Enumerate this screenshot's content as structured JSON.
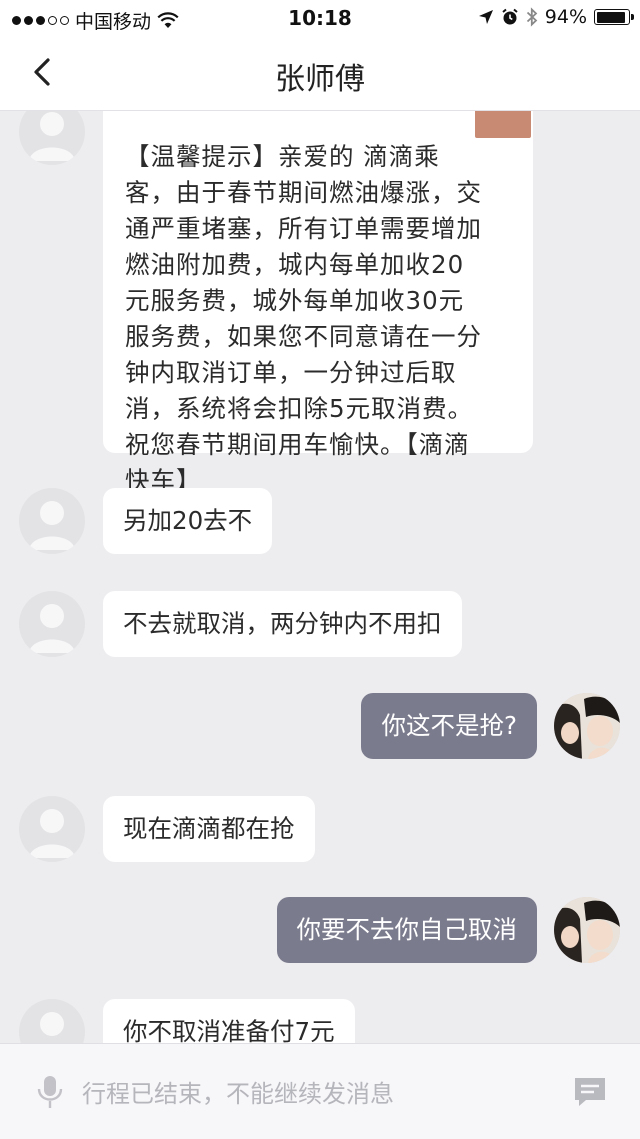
{
  "status_bar": {
    "carrier": "中国移动",
    "time": "10:18",
    "battery_percent": "94%",
    "battery_level": 0.94,
    "signal_bars_filled": 3,
    "signal_bars_total": 5
  },
  "nav": {
    "title": "张师傅",
    "back_icon": "chevron-left-icon"
  },
  "messages": [
    {
      "sender": "driver",
      "text": "【温馨提示】亲爱的     滴滴乘\n客，由于春节期间燃油爆涨，交\n通严重堵塞，所有订单需要增加\n燃油附加费，城内每单加收20\n元服务费，城外每单加收30元\n服务费，如果您不同意请在一分\n钟内取消订单，一分钟过后取\n消，系统将会扣除5元取消费。\n祝您春节期间用车愉快。【滴滴\n快车】"
    },
    {
      "sender": "driver",
      "text": "另加20去不"
    },
    {
      "sender": "driver",
      "text": "不去就取消，两分钟内不用扣"
    },
    {
      "sender": "me",
      "text": "你这不是抢?"
    },
    {
      "sender": "driver",
      "text": "现在滴滴都在抢"
    },
    {
      "sender": "me",
      "text": "你要不去你自己取消"
    },
    {
      "sender": "driver",
      "text": "你不取消准备付7元"
    }
  ],
  "input_bar": {
    "placeholder": "行程已结束，不能继续发消息",
    "mic_icon": "microphone-icon",
    "message_icon": "message-icon"
  },
  "colors": {
    "background": "#ededf0",
    "incoming_bubble": "#ffffff",
    "outgoing_bubble": "#7b7b8e",
    "redaction": "#c98a73"
  }
}
